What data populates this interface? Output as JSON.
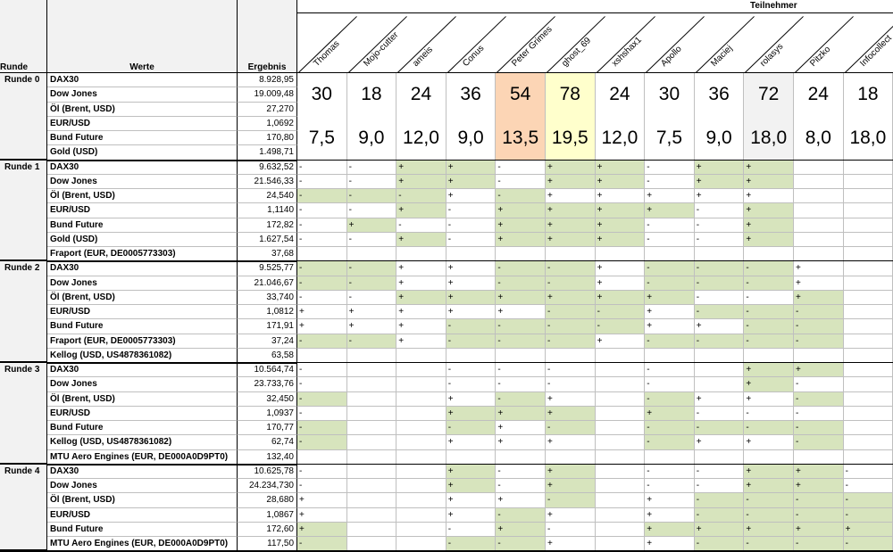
{
  "header": {
    "runde_label": "Runde",
    "werte_label": "Werte",
    "ergebnis_label": "Ergebnis",
    "teilnehmer_label": "Teilnehmer",
    "participants": [
      "Thomas",
      "Mojo-cutter",
      "ameis",
      "Conus",
      "Peter Grimes",
      "ghost_69",
      "xshshax1",
      "Apollo",
      "Maciej",
      "rolasys",
      "Pitzko",
      "Infocollect"
    ]
  },
  "colors": {
    "green_fill": "#d7e4bd",
    "orange_fill": "#fcd5b5",
    "yellow_fill": "#ffffcc",
    "gray_fill": "#f2f2f2",
    "grid_line": "#bfbfbf",
    "border": "#000000"
  },
  "rounds": [
    {
      "label": "Runde 0",
      "rows": [
        {
          "name": "DAX30",
          "value": "8.928,95"
        },
        {
          "name": "Dow Jones",
          "value": "19.009,48"
        },
        {
          "name": "Öl (Brent, USD)",
          "value": "27,270"
        },
        {
          "name": "EUR/USD",
          "value": "1,0692"
        },
        {
          "name": "Bund Future",
          "value": "170,80"
        },
        {
          "name": "Gold (USD)",
          "value": "1.498,71"
        }
      ],
      "scores": [
        "30",
        "18",
        "24",
        "36",
        "54",
        "78",
        "24",
        "30",
        "36",
        "72",
        "24",
        "18"
      ],
      "averages": [
        "7,5",
        "9,0",
        "12,0",
        "9,0",
        "13,5",
        "19,5",
        "12,0",
        "7,5",
        "9,0",
        "18,0",
        "8,0",
        "18,0"
      ]
    },
    {
      "label": "Runde 1",
      "rows": [
        {
          "name": "DAX30",
          "value": "9.632,52",
          "preds": [
            "-",
            "-",
            "+",
            "+",
            "-",
            "+",
            "+",
            "-",
            "+",
            "+",
            "",
            ""
          ],
          "hits": [
            0,
            0,
            1,
            1,
            0,
            1,
            1,
            0,
            1,
            1,
            0,
            0
          ]
        },
        {
          "name": "Dow Jones",
          "value": "21.546,33",
          "preds": [
            "-",
            "-",
            "+",
            "+",
            "-",
            "+",
            "+",
            "-",
            "+",
            "+",
            "",
            ""
          ],
          "hits": [
            0,
            0,
            1,
            1,
            0,
            1,
            1,
            0,
            1,
            1,
            0,
            0
          ]
        },
        {
          "name": "Öl (Brent, USD)",
          "value": "24,540",
          "preds": [
            "-",
            "-",
            "-",
            "+",
            "-",
            "+",
            "+",
            "+",
            "+",
            "+",
            "",
            ""
          ],
          "hits": [
            1,
            1,
            1,
            0,
            1,
            0,
            0,
            0,
            0,
            0,
            0,
            0
          ]
        },
        {
          "name": "EUR/USD",
          "value": "1,1140",
          "preds": [
            "-",
            "-",
            "+",
            "-",
            "+",
            "+",
            "+",
            "+",
            "-",
            "+",
            "",
            ""
          ],
          "hits": [
            0,
            0,
            1,
            0,
            1,
            1,
            1,
            1,
            0,
            1,
            0,
            0
          ]
        },
        {
          "name": "Bund Future",
          "value": "172,82",
          "preds": [
            "-",
            "+",
            "-",
            "-",
            "+",
            "+",
            "+",
            "-",
            "-",
            "+",
            "",
            ""
          ],
          "hits": [
            0,
            1,
            0,
            0,
            1,
            1,
            1,
            0,
            0,
            1,
            0,
            0
          ]
        },
        {
          "name": "Gold (USD)",
          "value": "1.627,54",
          "preds": [
            "-",
            "-",
            "+",
            "-",
            "+",
            "+",
            "+",
            "-",
            "-",
            "+",
            "",
            ""
          ],
          "hits": [
            0,
            0,
            1,
            0,
            1,
            1,
            1,
            0,
            0,
            1,
            0,
            0
          ]
        },
        {
          "name": "Fraport (EUR, DE0005773303)",
          "value": "37,68",
          "preds": [
            "",
            "",
            "",
            "",
            "",
            "",
            "",
            "",
            "",
            "",
            "",
            ""
          ],
          "hits": [
            0,
            0,
            0,
            0,
            0,
            0,
            0,
            0,
            0,
            0,
            0,
            0
          ]
        }
      ]
    },
    {
      "label": "Runde 2",
      "rows": [
        {
          "name": "DAX30",
          "value": "9.525,77",
          "preds": [
            "-",
            "-",
            "+",
            "+",
            "-",
            "-",
            "+",
            "-",
            "-",
            "-",
            "+",
            ""
          ],
          "hits": [
            1,
            1,
            0,
            0,
            1,
            1,
            0,
            1,
            1,
            1,
            0,
            0
          ]
        },
        {
          "name": "Dow Jones",
          "value": "21.046,67",
          "preds": [
            "-",
            "-",
            "+",
            "+",
            "-",
            "-",
            "+",
            "-",
            "-",
            "-",
            "+",
            ""
          ],
          "hits": [
            1,
            1,
            0,
            0,
            1,
            1,
            0,
            1,
            1,
            1,
            0,
            0
          ]
        },
        {
          "name": "Öl (Brent, USD)",
          "value": "33,740",
          "preds": [
            "-",
            "-",
            "+",
            "+",
            "+",
            "+",
            "+",
            "+",
            "-",
            "-",
            "+",
            ""
          ],
          "hits": [
            0,
            0,
            1,
            1,
            1,
            1,
            1,
            1,
            0,
            0,
            1,
            0
          ]
        },
        {
          "name": "EUR/USD",
          "value": "1,0812",
          "preds": [
            "+",
            "+",
            "+",
            "+",
            "+",
            "-",
            "-",
            "+",
            "-",
            "-",
            "-",
            ""
          ],
          "hits": [
            0,
            0,
            0,
            0,
            0,
            1,
            1,
            0,
            1,
            1,
            1,
            0
          ]
        },
        {
          "name": "Bund Future",
          "value": "171,91",
          "preds": [
            "+",
            "+",
            "+",
            "-",
            "-",
            "-",
            "-",
            "+",
            "+",
            "-",
            "-",
            ""
          ],
          "hits": [
            0,
            0,
            0,
            1,
            1,
            1,
            1,
            0,
            0,
            1,
            1,
            0
          ]
        },
        {
          "name": "Fraport (EUR, DE0005773303)",
          "value": "37,24",
          "preds": [
            "-",
            "-",
            "+",
            "-",
            "-",
            "-",
            "+",
            "-",
            "-",
            "-",
            "-",
            ""
          ],
          "hits": [
            1,
            1,
            0,
            1,
            1,
            1,
            0,
            1,
            1,
            1,
            1,
            0
          ]
        },
        {
          "name": "Kellog (USD, US4878361082)",
          "value": "63,58",
          "preds": [
            "",
            "",
            "",
            "",
            "",
            "",
            "",
            "",
            "",
            "",
            "",
            ""
          ],
          "hits": [
            0,
            0,
            0,
            0,
            0,
            0,
            0,
            0,
            0,
            0,
            0,
            0
          ]
        }
      ]
    },
    {
      "label": "Runde 3",
      "rows": [
        {
          "name": "DAX30",
          "value": "10.564,74",
          "preds": [
            "-",
            "",
            "",
            "-",
            "-",
            "-",
            "",
            "-",
            "",
            "+",
            "+",
            ""
          ],
          "hits": [
            0,
            0,
            0,
            0,
            0,
            0,
            0,
            0,
            0,
            1,
            1,
            0
          ]
        },
        {
          "name": "Dow Jones",
          "value": "23.733,76",
          "preds": [
            "-",
            "",
            "",
            "-",
            "-",
            "-",
            "",
            "-",
            "",
            "+",
            "-",
            ""
          ],
          "hits": [
            0,
            0,
            0,
            0,
            0,
            0,
            0,
            0,
            0,
            1,
            0,
            0
          ]
        },
        {
          "name": "Öl (Brent, USD)",
          "value": "32,450",
          "preds": [
            "-",
            "",
            "",
            "+",
            "-",
            "+",
            "",
            "-",
            "+",
            "+",
            "-",
            ""
          ],
          "hits": [
            1,
            0,
            0,
            0,
            1,
            0,
            0,
            1,
            0,
            0,
            1,
            0
          ]
        },
        {
          "name": "EUR/USD",
          "value": "1,0937",
          "preds": [
            "-",
            "",
            "",
            "+",
            "+",
            "+",
            "",
            "+",
            "-",
            "-",
            "-",
            ""
          ],
          "hits": [
            0,
            0,
            0,
            1,
            1,
            1,
            0,
            1,
            0,
            0,
            0,
            0
          ]
        },
        {
          "name": "Bund Future",
          "value": "170,77",
          "preds": [
            "-",
            "",
            "",
            "-",
            "+",
            "-",
            "",
            "-",
            "-",
            "-",
            "-",
            ""
          ],
          "hits": [
            1,
            0,
            0,
            1,
            0,
            1,
            0,
            1,
            1,
            1,
            1,
            0
          ]
        },
        {
          "name": "Kellog (USD, US4878361082)",
          "value": "62,74",
          "preds": [
            "-",
            "",
            "",
            "+",
            "+",
            "+",
            "",
            "-",
            "+",
            "+",
            "-",
            ""
          ],
          "hits": [
            1,
            0,
            0,
            0,
            0,
            0,
            0,
            1,
            0,
            0,
            1,
            0
          ]
        },
        {
          "name": "MTU Aero Engines (EUR, DE000A0D9PT0)",
          "value": "132,40",
          "preds": [
            "",
            "",
            "",
            "",
            "",
            "",
            "",
            "",
            "",
            "",
            "",
            ""
          ],
          "hits": [
            0,
            0,
            0,
            0,
            0,
            0,
            0,
            0,
            0,
            0,
            0,
            0
          ]
        }
      ]
    },
    {
      "label": "Runde 4",
      "rows": [
        {
          "name": "DAX30",
          "value": "10.625,78",
          "preds": [
            "-",
            "",
            "",
            "+",
            "-",
            "+",
            "",
            "-",
            "-",
            "+",
            "+",
            "-"
          ],
          "hits": [
            0,
            0,
            0,
            1,
            0,
            1,
            0,
            0,
            0,
            1,
            1,
            0
          ]
        },
        {
          "name": "Dow Jones",
          "value": "24.234,730",
          "preds": [
            "-",
            "",
            "",
            "+",
            "-",
            "+",
            "",
            "-",
            "-",
            "+",
            "+",
            "-"
          ],
          "hits": [
            0,
            0,
            0,
            1,
            0,
            1,
            0,
            0,
            0,
            1,
            1,
            0
          ]
        },
        {
          "name": "Öl (Brent, USD)",
          "value": "28,680",
          "preds": [
            "+",
            "",
            "",
            "+",
            "+",
            "-",
            "",
            "+",
            "-",
            "-",
            "-",
            "-"
          ],
          "hits": [
            0,
            0,
            0,
            0,
            0,
            1,
            0,
            0,
            1,
            1,
            1,
            1
          ]
        },
        {
          "name": "EUR/USD",
          "value": "1,0867",
          "preds": [
            "+",
            "",
            "",
            "+",
            "-",
            "+",
            "",
            "+",
            "-",
            "-",
            "-",
            "-"
          ],
          "hits": [
            0,
            0,
            0,
            0,
            1,
            0,
            0,
            0,
            1,
            1,
            1,
            1
          ]
        },
        {
          "name": "Bund Future",
          "value": "172,60",
          "preds": [
            "+",
            "",
            "",
            "-",
            "+",
            "-",
            "",
            "+",
            "+",
            "+",
            "+",
            "+"
          ],
          "hits": [
            1,
            0,
            0,
            0,
            1,
            0,
            0,
            1,
            1,
            1,
            1,
            1
          ]
        },
        {
          "name": "MTU Aero Engines (EUR, DE000A0D9PT0)",
          "value": "117,50",
          "preds": [
            "-",
            "",
            "",
            "-",
            "-",
            "+",
            "",
            "+",
            "-",
            "-",
            "-",
            "-"
          ],
          "hits": [
            1,
            0,
            0,
            1,
            1,
            0,
            0,
            0,
            1,
            1,
            1,
            1
          ]
        }
      ]
    }
  ]
}
